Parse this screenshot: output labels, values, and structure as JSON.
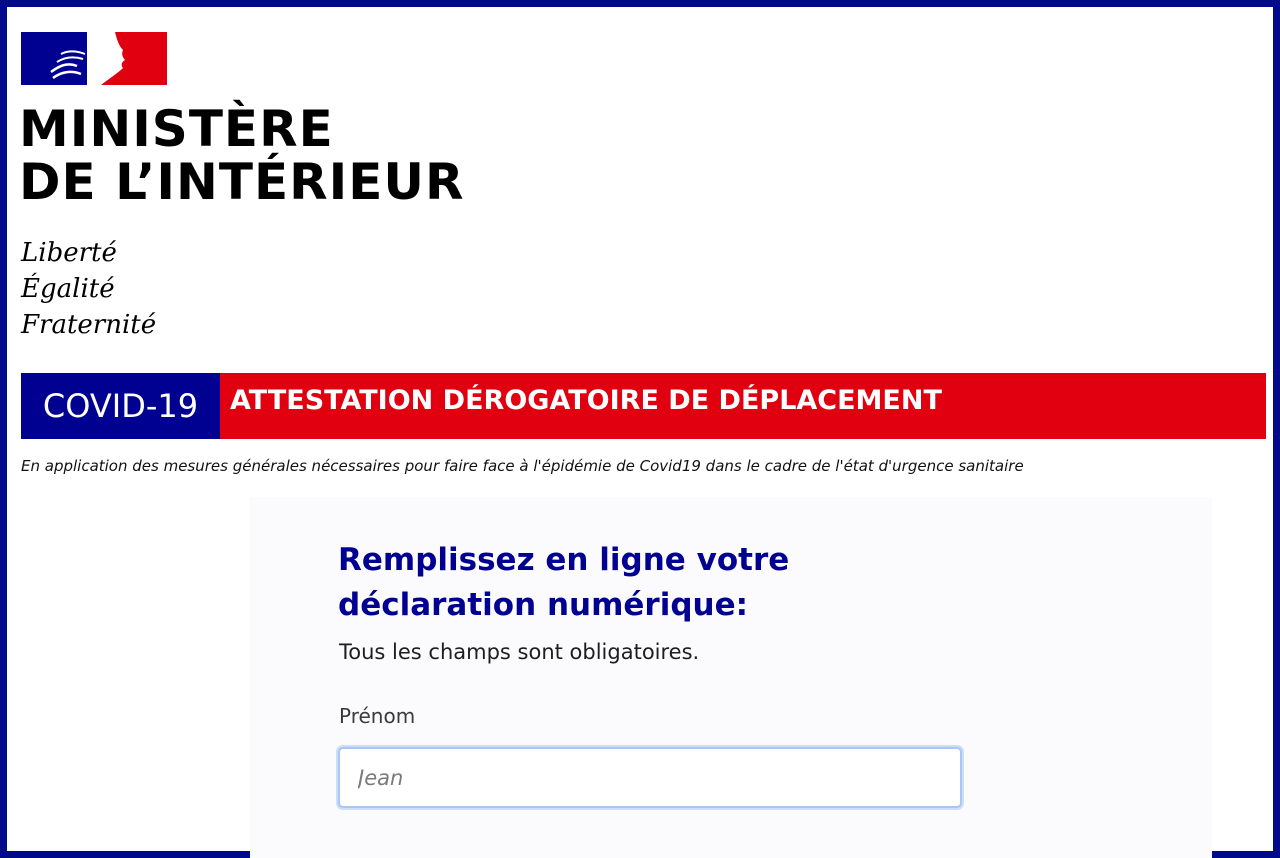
{
  "header": {
    "ministry_line1": "MINISTÈRE",
    "ministry_line2": "DE L’INTÉRIEUR",
    "motto": [
      "Liberté",
      "Égalité",
      "Fraternité"
    ]
  },
  "banner": {
    "covid_label": "COVID-19",
    "title": "ATTESTATION DÉROGATOIRE DE DÉPLACEMENT"
  },
  "subtitle": "En application des mesures générales nécessaires pour faire face à l'épidémie de Covid19 dans le cadre de l'état d'urgence sanitaire",
  "form": {
    "heading_line1": "Remplissez en ligne votre",
    "heading_line2": "déclaration numérique:",
    "required_note": "Tous les champs sont obligatoires.",
    "firstname_label": "Prénom",
    "firstname_placeholder": "Jean",
    "firstname_value": ""
  },
  "colors": {
    "frame_border": "#020a8c",
    "republic_blue": "#000091",
    "republic_red": "#e1000f",
    "form_background": "#fbfbfd",
    "input_focus_border": "#a8c7f4"
  },
  "icons": {
    "logo": "marianne-flag-icon"
  }
}
